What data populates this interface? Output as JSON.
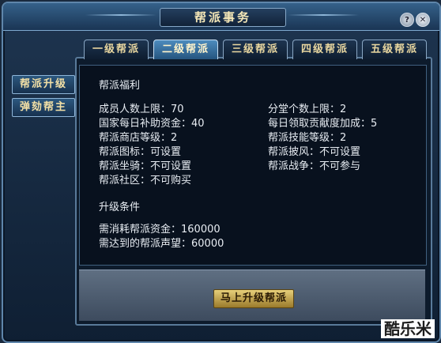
{
  "window": {
    "title": "帮派事务"
  },
  "sidebar": {
    "items": [
      {
        "label": "帮派升级"
      },
      {
        "label": "弹劾帮主"
      }
    ]
  },
  "tabs": [
    {
      "label": "一级帮派",
      "active": false
    },
    {
      "label": "二级帮派",
      "active": true
    },
    {
      "label": "三级帮派",
      "active": false
    },
    {
      "label": "四级帮派",
      "active": false
    },
    {
      "label": "五级帮派",
      "active": false
    }
  ],
  "benefits": {
    "title": "帮派福利",
    "left": [
      "成员人数上限：70",
      "国家每日补助资金：40",
      "帮派商店等级：2",
      "帮派图标：可设置",
      "帮派坐骑：不可设置",
      "帮派社区：不可购买"
    ],
    "right": [
      "分堂个数上限：2",
      "每日领取贡献度加成：5",
      "帮派技能等级：2",
      "帮派披风：不可设置",
      "帮派战争：不可参与"
    ]
  },
  "requirements": {
    "title": "升级条件",
    "items": [
      "需消耗帮派资金：160000",
      "需达到的帮派声望：60000"
    ]
  },
  "actions": {
    "upgrade_label": "马上升级帮派"
  },
  "icons": {
    "help": "question-icon",
    "close": "close-icon"
  },
  "watermark": "酷乐米"
}
